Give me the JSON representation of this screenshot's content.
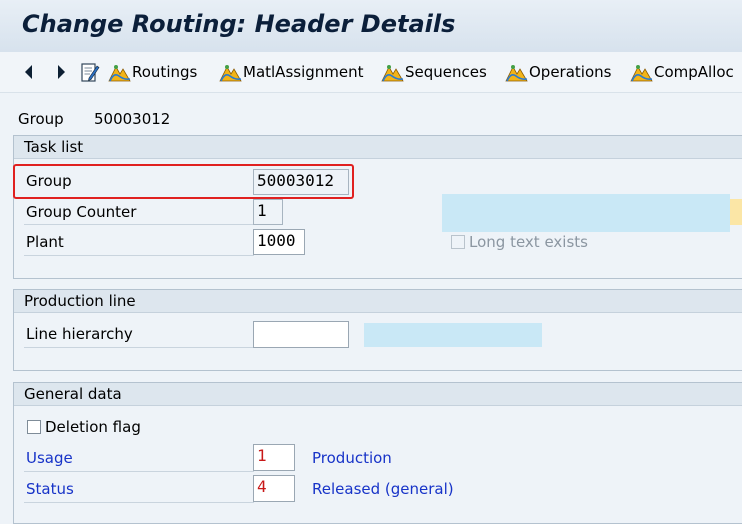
{
  "title": "Change Routing: Header Details",
  "toolbar": {
    "buttons": [
      "Routings",
      "MatlAssignment",
      "Sequences",
      "Operations",
      "CompAlloc"
    ]
  },
  "header": {
    "group_label": "Group",
    "group_value": "50003012"
  },
  "task_list": {
    "heading": "Task list",
    "group_label": "Group",
    "group_value": "50003012",
    "counter_label": "Group Counter",
    "counter_value": "1",
    "plant_label": "Plant",
    "plant_value": "1000",
    "long_text_label": "Long text exists"
  },
  "production_line": {
    "heading": "Production line",
    "line_hierarchy_label": "Line hierarchy",
    "line_hierarchy_value": ""
  },
  "general_data": {
    "heading": "General data",
    "deletion_flag_label": "Deletion flag",
    "usage_label": "Usage",
    "usage_value": "1",
    "usage_text": "Production",
    "status_label": "Status",
    "status_value": "4",
    "status_text": "Released (general)"
  }
}
